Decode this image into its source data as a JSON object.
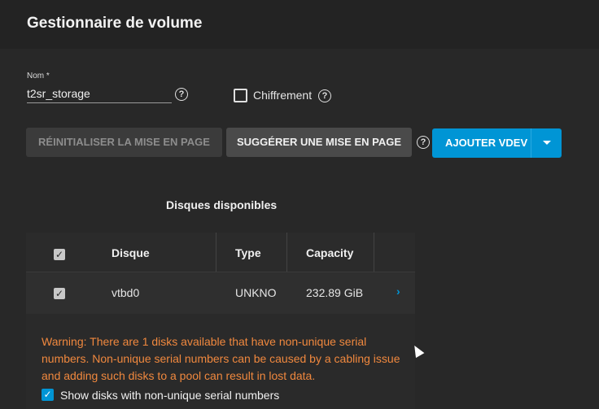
{
  "header": {
    "title": "Gestionnaire de volume"
  },
  "form": {
    "name_label": "Nom *",
    "name_value": "t2sr_storage",
    "encryption_label": "Chiffrement",
    "help_glyph": "?"
  },
  "buttons": {
    "reset_label": "RÉINITIALISER LA MISE EN PAGE",
    "suggest_label": "SUGGÉRER UNE MISE EN PAGE",
    "add_vdev_label": "AJOUTER VDEV"
  },
  "available": {
    "title": "Disques disponibles",
    "columns": [
      "Disque",
      "Type",
      "Capacity"
    ],
    "rows": [
      {
        "disk": "vtbd0",
        "type": "UNKNO",
        "capacity": "232.89 GiB"
      }
    ],
    "warning": "Warning: There are 1 disks available that have non-unique serial numbers. Non-unique serial numbers can be caused by a cabling issue and adding such disks to a pool can result in lost data.",
    "show_nonunique_label": "Show disks with non-unique serial numbers"
  },
  "colors": {
    "accent": "#0095d5",
    "warning": "#f0883e",
    "background": "#282828"
  },
  "icons": [
    "help-icon",
    "checkbox-icon",
    "chevron-down-icon",
    "chevron-right-icon",
    "cursor-icon"
  ]
}
